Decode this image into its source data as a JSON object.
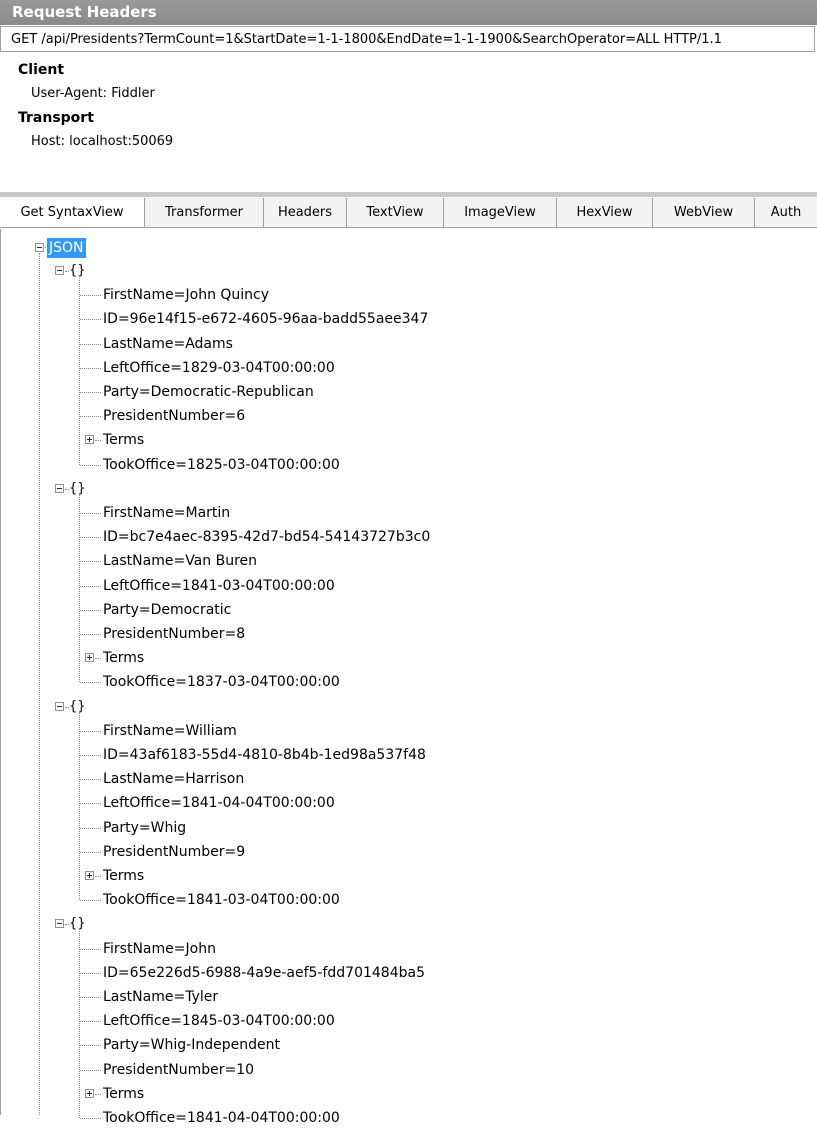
{
  "request_headers": {
    "title": "Request Headers",
    "request_line": "GET /api/Presidents?TermCount=1&StartDate=1-1-1800&EndDate=1-1-1900&SearchOperator=ALL HTTP/1.1",
    "sections": [
      {
        "title": "Client",
        "rows": [
          "User-Agent: Fiddler"
        ]
      },
      {
        "title": "Transport",
        "rows": [
          "Host: localhost:50069"
        ]
      }
    ]
  },
  "tabs": [
    {
      "label": "Get SyntaxView",
      "active": true
    },
    {
      "label": "Transformer"
    },
    {
      "label": "Headers"
    },
    {
      "label": "TextView"
    },
    {
      "label": "ImageView"
    },
    {
      "label": "HexView"
    },
    {
      "label": "WebView"
    },
    {
      "label": "Auth"
    }
  ],
  "tree": {
    "root": "JSON",
    "object_glyph": "{}",
    "objects": [
      {
        "items": [
          "FirstName=John Quincy",
          "ID=96e14f15-e672-4605-96aa-badd55aee347",
          "LastName=Adams",
          "LeftOffice=1829-03-04T00:00:00",
          "Party=Democratic-Republican",
          "PresidentNumber=6",
          "Terms",
          "TookOffice=1825-03-04T00:00:00"
        ]
      },
      {
        "items": [
          "FirstName=Martin",
          "ID=bc7e4aec-8395-42d7-bd54-54143727b3c0",
          "LastName=Van Buren",
          "LeftOffice=1841-03-04T00:00:00",
          "Party=Democratic",
          "PresidentNumber=8",
          "Terms",
          "TookOffice=1837-03-04T00:00:00"
        ]
      },
      {
        "items": [
          "FirstName=William",
          "ID=43af6183-55d4-4810-8b4b-1ed98a537f48",
          "LastName=Harrison",
          "LeftOffice=1841-04-04T00:00:00",
          "Party=Whig",
          "PresidentNumber=9",
          "Terms",
          "TookOffice=1841-03-04T00:00:00"
        ]
      },
      {
        "items": [
          "FirstName=John",
          "ID=65e226d5-6988-4a9e-aef5-fdd701484ba5",
          "LastName=Tyler",
          "LeftOffice=1845-03-04T00:00:00",
          "Party=Whig-Independent",
          "PresidentNumber=10",
          "Terms",
          "TookOffice=1841-04-04T00:00:00"
        ]
      }
    ]
  }
}
